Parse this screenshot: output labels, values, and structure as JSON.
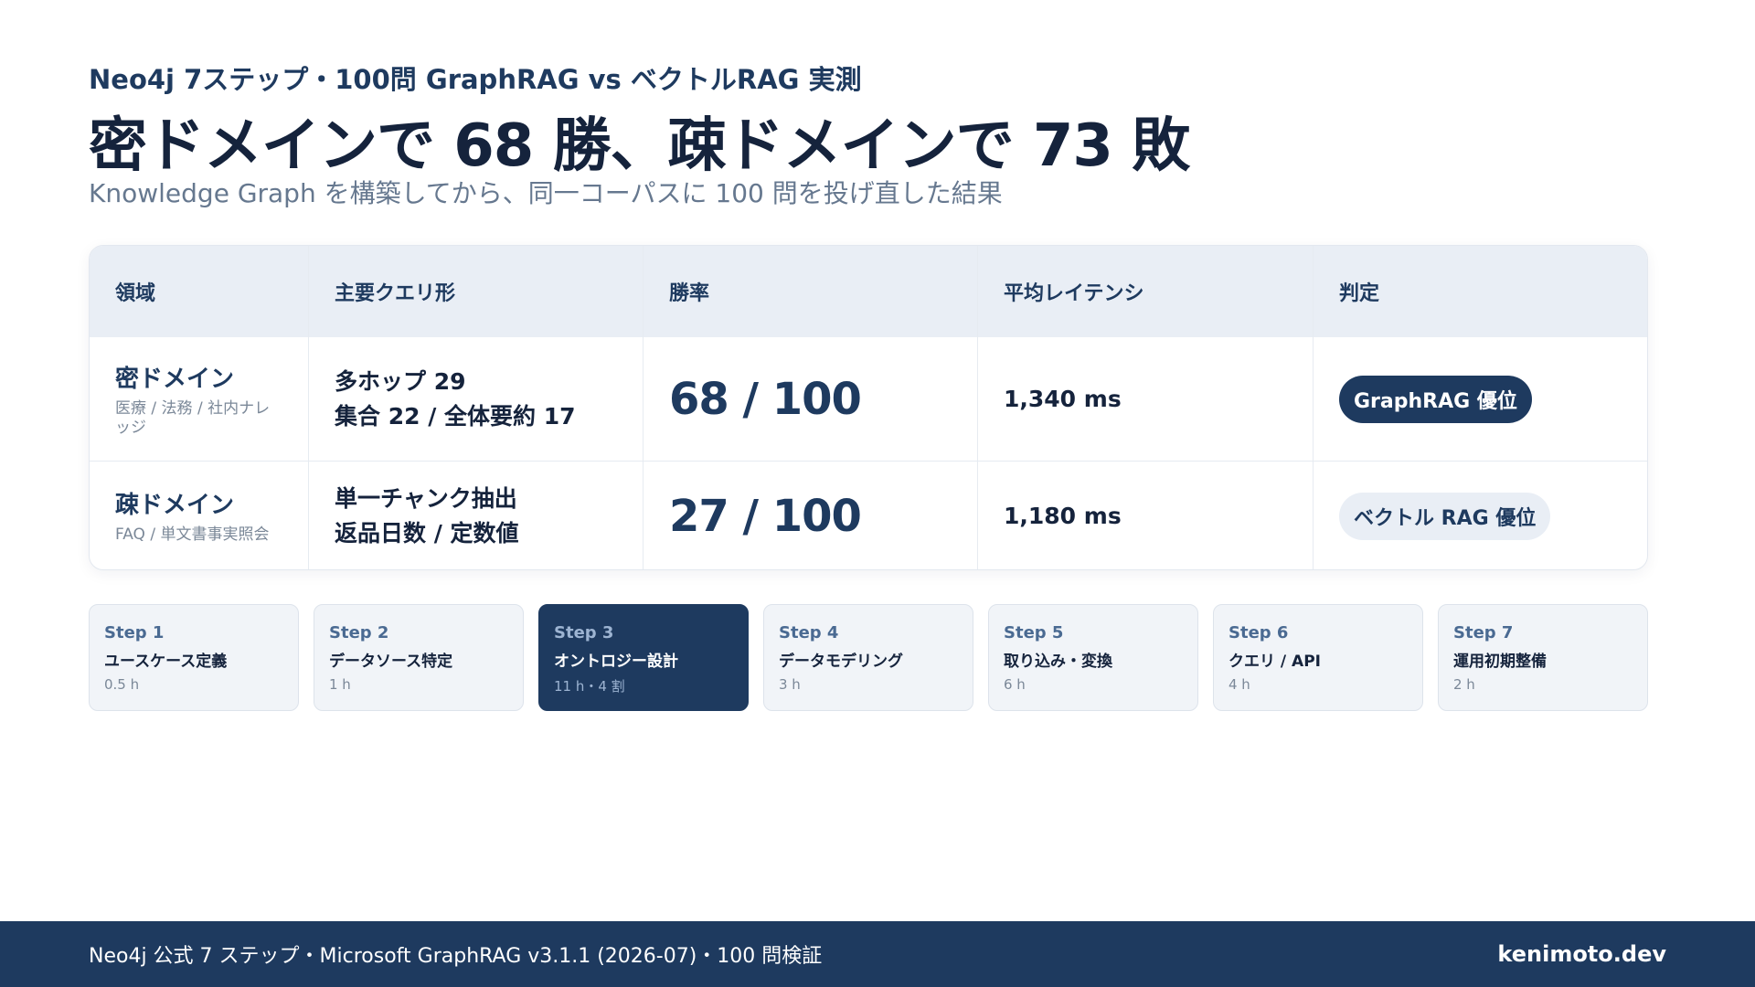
{
  "header": {
    "eyebrow": "Neo4j 7ステップ・100問 GraphRAG vs ベクトルRAG 実測",
    "headline": "密ドメインで 68 勝、疎ドメインで 73 敗",
    "subtitle": "Knowledge Graph を構築してから、同一コーパスに 100 問を投げ直した結果"
  },
  "table": {
    "columns": [
      "領域",
      "主要クエリ形",
      "勝率",
      "平均レイテンシ",
      "判定"
    ],
    "rows": [
      {
        "domain": "密ドメイン",
        "domain_desc": "医療 / 法務 / 社内ナレッジ",
        "query_line1": "多ホップ 29",
        "query_line2": "集合 22 / 全体要約 17",
        "winrate": "68 / 100",
        "latency": "1,340 ms",
        "verdict": "GraphRAG 優位"
      },
      {
        "domain": "疎ドメイン",
        "domain_desc": "FAQ / 単文書事実照会",
        "query_line1": "単一チャンク抽出",
        "query_line2": "返品日数 / 定数値",
        "winrate": "27 / 100",
        "latency": "1,180 ms",
        "verdict": "ベクトル RAG 優位"
      }
    ]
  },
  "steps": [
    {
      "num": "Step 1",
      "title": "ユースケース定義",
      "time": "0.5 h"
    },
    {
      "num": "Step 2",
      "title": "データソース特定",
      "time": "1 h"
    },
    {
      "num": "Step 3",
      "title": "オントロジー設計",
      "time": "11 h・4 割",
      "active": true
    },
    {
      "num": "Step 4",
      "title": "データモデリング",
      "time": "3 h"
    },
    {
      "num": "Step 5",
      "title": "取り込み・変換",
      "time": "6 h"
    },
    {
      "num": "Step 6",
      "title": "クエリ / API",
      "time": "4 h"
    },
    {
      "num": "Step 7",
      "title": "運用初期整備",
      "time": "2 h"
    }
  ],
  "footer": {
    "text": "Neo4j 公式 7 ステップ・Microsoft GraphRAG v3.1.1 (2026-07)・100 問検証",
    "brand": "kenimoto.dev"
  },
  "colors": {
    "accent": "#1e3a5f",
    "header_bg": "#e9eef5",
    "muted_text": "#66788f"
  }
}
